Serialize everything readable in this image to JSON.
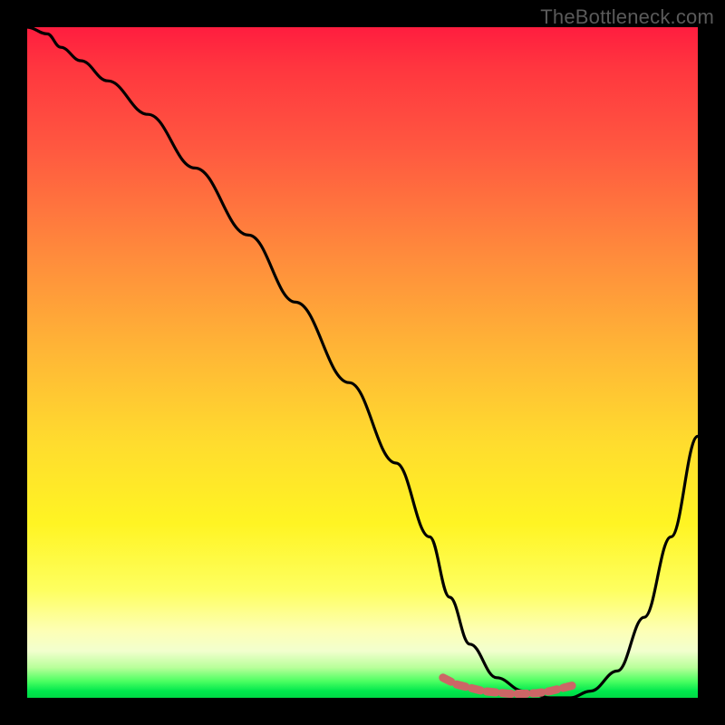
{
  "watermark": "TheBottleneck.com",
  "colors": {
    "page_bg": "#000000",
    "gradient_top": "#ff1d3f",
    "gradient_mid1": "#ff8b3c",
    "gradient_mid2": "#ffdc2e",
    "gradient_bottom": "#00d945",
    "curve_stroke": "#000000",
    "bottom_marker": "#cc6666"
  },
  "chart_data": {
    "type": "line",
    "title": "",
    "xlabel": "",
    "ylabel": "",
    "xlim": [
      0,
      100
    ],
    "ylim": [
      0,
      100
    ],
    "series": [
      {
        "name": "main-curve",
        "x": [
          0,
          3,
          5,
          8,
          12,
          18,
          25,
          33,
          40,
          48,
          55,
          60,
          63,
          66,
          70,
          74,
          78,
          81,
          84,
          88,
          92,
          96,
          100
        ],
        "values": [
          100,
          99,
          97,
          95,
          92,
          87,
          79,
          69,
          59,
          47,
          35,
          24,
          15,
          8,
          3,
          1,
          0,
          0,
          1,
          4,
          12,
          24,
          39
        ]
      },
      {
        "name": "bottom-band",
        "x": [
          62,
          64,
          66,
          68,
          70,
          72,
          74,
          76,
          78,
          80,
          82
        ],
        "values": [
          3,
          2,
          1.5,
          1,
          0.8,
          0.6,
          0.6,
          0.7,
          1,
          1.5,
          2
        ]
      }
    ],
    "grid": false,
    "legend": false
  }
}
